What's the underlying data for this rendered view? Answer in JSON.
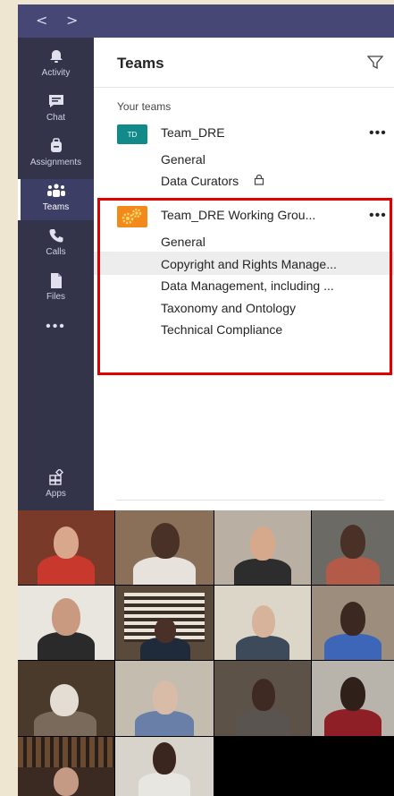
{
  "titlebar": {
    "back_icon": "chevron-left-icon",
    "forward_icon": "chevron-right-icon",
    "color": "#464775"
  },
  "rail": {
    "items": [
      {
        "label": "Activity",
        "icon": "bell-icon"
      },
      {
        "label": "Chat",
        "icon": "chat-icon"
      },
      {
        "label": "Assignments",
        "icon": "backpack-icon"
      },
      {
        "label": "Teams",
        "icon": "teams-icon",
        "active": true
      },
      {
        "label": "Calls",
        "icon": "phone-icon"
      },
      {
        "label": "Files",
        "icon": "file-icon"
      },
      {
        "label": "",
        "icon": "more-apps-icon"
      }
    ],
    "apps": {
      "label": "Apps",
      "icon": "apps-icon"
    }
  },
  "panel": {
    "title": "Teams",
    "section_label": "Your teams",
    "teams": [
      {
        "initials": "TD",
        "name": "Team_DRE",
        "more": "•••",
        "channels": [
          "General",
          "Data Curators"
        ]
      },
      {
        "name": "Team_DRE Working Grou...",
        "more": "•••",
        "channels": [
          "General",
          "Copyright and Rights Manage...",
          "Data Management, including ...",
          "Taxonomy and Ontology",
          "Technical Compliance"
        ]
      }
    ]
  },
  "colors": {
    "rail_bg": "#33344a",
    "highlight_border": "#e00000",
    "team_td_avatar": "#138a8a",
    "team_wg_avatar": "#f28a1b"
  }
}
